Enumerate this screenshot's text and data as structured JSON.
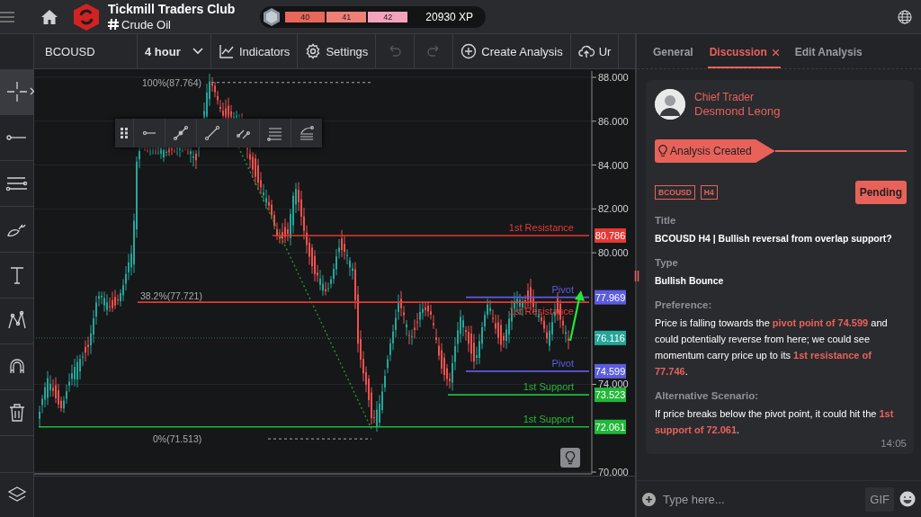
{
  "header": {
    "title": "Tickmill Traders Club",
    "channel": "Crude Oil",
    "levels": [
      {
        "label": "40",
        "color": "#e8675a"
      },
      {
        "label": "41",
        "color": "#ef8078"
      },
      {
        "label": "42",
        "color": "#f5a3bd"
      }
    ],
    "xp": "20930 XP"
  },
  "tools": [
    {
      "kind": "crosshair",
      "selected": true
    },
    {
      "kind": "line",
      "selected": false
    },
    {
      "kind": "parallel",
      "selected": false
    },
    {
      "kind": "brush",
      "selected": false
    },
    {
      "kind": "text",
      "selected": false
    },
    {
      "kind": "pattern",
      "selected": false
    },
    {
      "kind": "magnet",
      "selected": false
    },
    {
      "kind": "trash",
      "selected": false
    },
    {
      "kind": "layers",
      "selected": false
    }
  ],
  "chart_toolbar": {
    "symbol": "BCOUSD",
    "interval": "4 hour",
    "buttons": [
      {
        "kind": "indicators",
        "label": "Indicators",
        "disabled": false
      },
      {
        "kind": "settings",
        "label": "Settings",
        "disabled": false
      },
      {
        "kind": "undo",
        "disabled": true
      },
      {
        "kind": "redo",
        "disabled": true
      },
      {
        "kind": "create",
        "label": "Create Analysis",
        "disabled": false
      },
      {
        "kind": "upload",
        "label": "Ur",
        "disabled": false
      }
    ]
  },
  "drawing_toolbar": [
    {
      "kind": "ray"
    },
    {
      "kind": "segment-dot"
    },
    {
      "kind": "segment"
    },
    {
      "kind": "parallel-segment"
    },
    {
      "kind": "lines"
    },
    {
      "kind": "fan"
    }
  ],
  "chart": {
    "price_ticks": [
      "88.000",
      "86.000",
      "84.000",
      "82.000",
      "80.000",
      "74.000",
      "70.000"
    ],
    "levels": [
      {
        "label": "1st Resistance",
        "tag": "80.786",
        "color": "#e53935"
      },
      {
        "label": "Pivot",
        "tag": "77.969",
        "color": "#5c5ce0"
      },
      {
        "label": "1st Resistance",
        "color": "#e53935"
      },
      {
        "label": "Pivot",
        "tag": "74.599",
        "color": "#5c5ce0"
      },
      {
        "label": "1st Support",
        "tag": "73.523",
        "color": "#22b83a"
      },
      {
        "label": "1st Support",
        "tag": "72.061",
        "color": "#22b83a"
      }
    ],
    "current_price": "76.116",
    "fib": [
      "100%(87.764)",
      "38.2%(77.721)",
      "0%(71.513)"
    ]
  },
  "panel": {
    "tabs": [
      {
        "label": "General",
        "selected": false,
        "closable": false
      },
      {
        "label": "Discussion",
        "selected": true,
        "closable": true
      },
      {
        "label": "Edit Analysis",
        "selected": false,
        "closable": false
      }
    ],
    "author_role": "Chief Trader",
    "author_name": "Desmond Leong",
    "banner": "Analysis Created",
    "tags": [
      "BCOUSD",
      "H4"
    ],
    "status": "Pending",
    "fields": [
      {
        "label": "Title",
        "value": "BCOUSD H4 | Bullish reversal from overlap support?",
        "kind": "heading"
      },
      {
        "label": "Type",
        "value": "Bullish Bounce",
        "kind": "heading"
      },
      {
        "label": "Preference:",
        "value": "Price is falling towards the **pivot point of 74.599** and could potentially reverse from here; we could see momentum carry price up to its **1st resistance of 77.746**.",
        "kind": "text"
      },
      {
        "label": "Alternative Scenario:",
        "value": "If price breaks below the pivot point, it could hit the **1st support of 72.061**.",
        "kind": "text"
      }
    ],
    "time": "14:05",
    "composer": {
      "placeholder": "Type here...",
      "gif": "GIF"
    }
  }
}
